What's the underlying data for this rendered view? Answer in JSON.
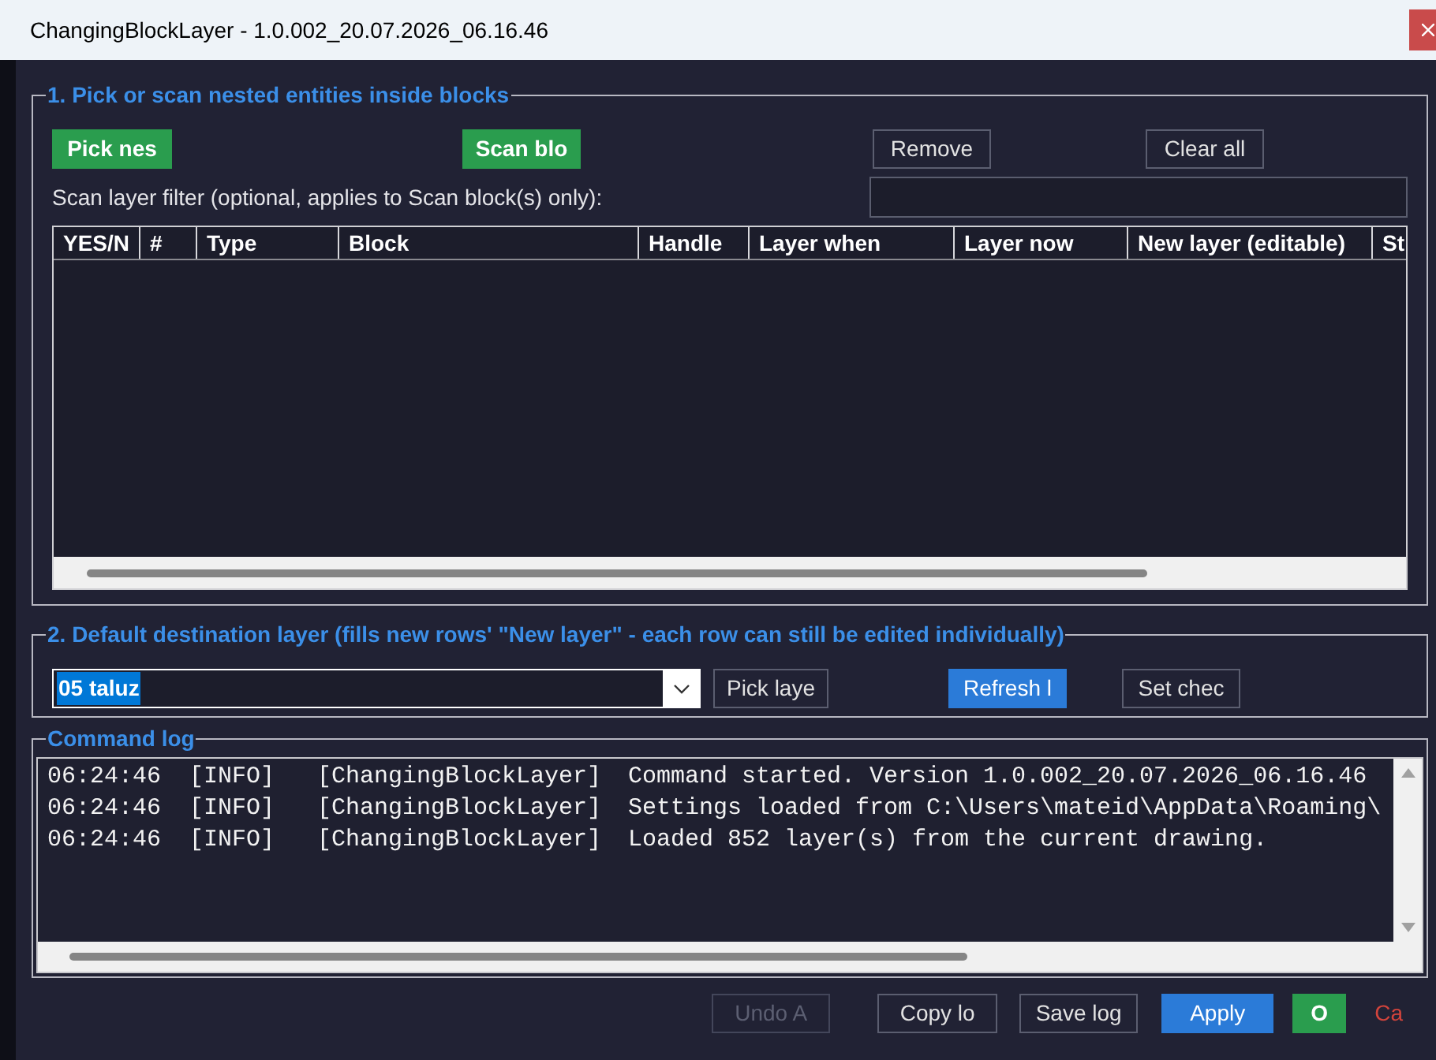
{
  "window": {
    "title": "ChangingBlockLayer - 1.0.002_20.07.2026_06.16.46"
  },
  "pick_section": {
    "legend": "1. Pick or scan nested entities inside blocks",
    "buttons": [
      {
        "label": "Pick nes",
        "kind": "success"
      },
      {
        "label": "Scan blo",
        "kind": "success"
      },
      {
        "label": "Remove",
        "kind": "default"
      },
      {
        "label": "Clear all",
        "kind": "default"
      }
    ],
    "filter": {
      "label": "Scan layer filter (optional, applies to Scan block(s) only):"
    },
    "table": {
      "columns": [
        "YES/N",
        "#",
        "Type",
        "Block",
        "Handle",
        "Layer when",
        "Layer now",
        "New layer (editable)",
        "St"
      ]
    }
  },
  "destination_section": {
    "legend": "2. Default destination layer (fills new rows' \"New layer\" - each row can still be edited individually)",
    "layer_combo": {
      "value": "05 taluz",
      "text_selected": true
    },
    "buttons": [
      {
        "label": "Pick laye",
        "kind": "default"
      },
      {
        "label": "Refresh l",
        "kind": "primary"
      },
      {
        "label": "Set chec",
        "kind": "default"
      }
    ]
  },
  "log_section": {
    "legend": "Command log",
    "lines": [
      {
        "time": "06:24:46",
        "level": "[INFO]",
        "source": "[ChangingBlockLayer]",
        "message": "Command started. Version 1.0.002_20.07.2026_06.16.46"
      },
      {
        "time": "06:24:46",
        "level": "[INFO]",
        "source": "[ChangingBlockLayer]",
        "message": "Settings loaded from C:\\Users\\mateid\\AppData\\Roaming\\"
      },
      {
        "time": "06:24:46",
        "level": "[INFO]",
        "source": "[ChangingBlockLayer]",
        "message": "Loaded 852 layer(s) from the current drawing."
      }
    ]
  },
  "footer": {
    "buttons": [
      {
        "label": "Undo A",
        "kind": "default",
        "disabled": true
      },
      {
        "label": "Copy lo",
        "kind": "default",
        "disabled": false
      },
      {
        "label": "Save log",
        "kind": "default",
        "disabled": false
      },
      {
        "label": "Apply",
        "kind": "primary",
        "disabled": false
      },
      {
        "label": "O",
        "kind": "success",
        "disabled": false
      },
      {
        "label": "Ca",
        "kind": "danger_text",
        "disabled": false
      }
    ]
  }
}
